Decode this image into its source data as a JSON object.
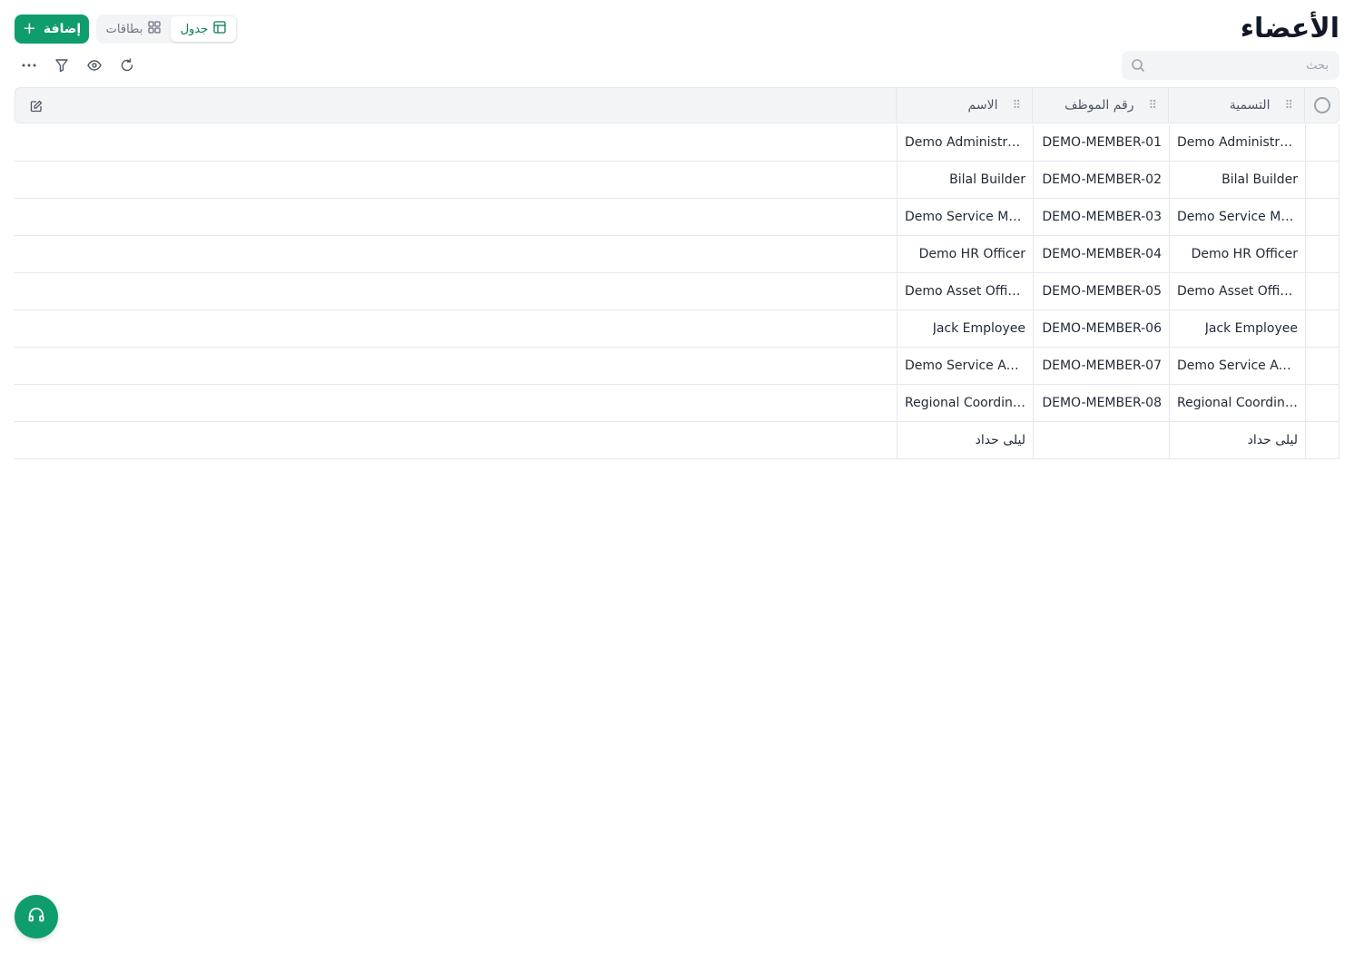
{
  "page": {
    "title": "الأعضاء"
  },
  "toolbar": {
    "add_label": "إضافة",
    "view_table_label": "جدول",
    "view_cards_label": "بطاقات",
    "active_view": "جدول"
  },
  "search": {
    "placeholder": "بحث",
    "value": ""
  },
  "actions": {
    "icons": [
      "refresh-icon",
      "eye-icon",
      "filter-icon",
      "more-icon"
    ]
  },
  "table": {
    "columns": [
      "التسمية",
      "رقم الموظف",
      "الاسم"
    ],
    "rows": [
      {
        "label": "Demo Administrator",
        "employee_id": "DEMO-MEMBER-01",
        "name": "Demo Administrator"
      },
      {
        "label": "Bilal Builder",
        "employee_id": "DEMO-MEMBER-02",
        "name": "Bilal Builder"
      },
      {
        "label": "Demo Service Manager",
        "employee_id": "DEMO-MEMBER-03",
        "name": "Demo Service Manager"
      },
      {
        "label": "Demo HR Officer",
        "employee_id": "DEMO-MEMBER-04",
        "name": "Demo HR Officer"
      },
      {
        "label": "Demo Asset Officer",
        "employee_id": "DEMO-MEMBER-05",
        "name": "Demo Asset Officer"
      },
      {
        "label": "Jack Employee",
        "employee_id": "DEMO-MEMBER-06",
        "name": "Jack Employee"
      },
      {
        "label": "Demo Service Adviser",
        "employee_id": "DEMO-MEMBER-07",
        "name": "Demo Service Adviser"
      },
      {
        "label": "Regional Coordinator",
        "employee_id": "DEMO-MEMBER-08",
        "name": "Regional Coordinator"
      },
      {
        "label": "ليلى حداد",
        "employee_id": "",
        "name": "ليلى حداد"
      }
    ]
  },
  "colors": {
    "accent": "#0f9d6e",
    "accent_text": "#0f7a57"
  }
}
